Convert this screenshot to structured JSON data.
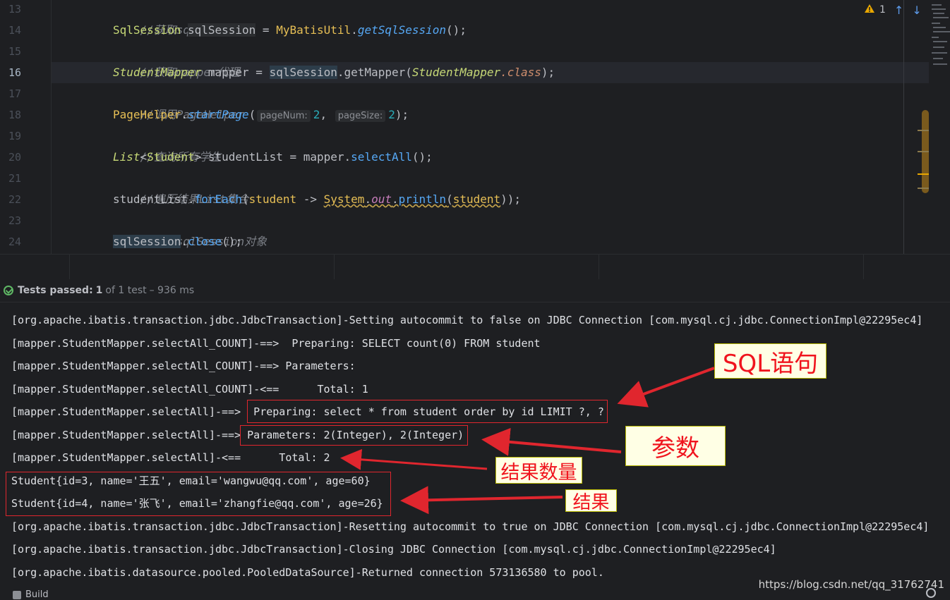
{
  "editor": {
    "line_numbers": [
      "13",
      "14",
      "15",
      "16",
      "17",
      "18",
      "19",
      "20",
      "21",
      "22",
      "23",
      "24"
    ],
    "current_line": "16",
    "inspection": {
      "warning_count": "1"
    },
    "lines": {
      "l13": "//获取sqlSession",
      "l14": {
        "type": "SqlSession",
        "var": "sqlSession",
        "eq": " = ",
        "cls": "MyBatisUtil",
        "dot": ".",
        "method": "getSqlSession",
        "end": "();"
      },
      "l15": "//获取mapper代理",
      "l16": {
        "type": "StudentMapper",
        "var": " mapper = ",
        "recv": "sqlSession",
        "call": ".getMapper(",
        "arg": "StudentMapper",
        "kw": ".class",
        "end": ");"
      },
      "l17": "//调用PageHelper",
      "l18": {
        "cls": "PageHelper",
        "dot": ".",
        "method": "startPage",
        "open": "(",
        "hint1": "pageNum:",
        "v1": "2",
        "comma": ", ",
        "hint2": "pageSize:",
        "v2": "2",
        "end": ");"
      },
      "l19": "//查询所有学生",
      "l20": {
        "type": "List",
        "lt": "<",
        "generic": "Student",
        "rest": "> studentList = mapper.",
        "method": "selectAll",
        "end": "();"
      },
      "l21": "//遍历结果List集合",
      "l22": {
        "recv": "studentList.",
        "method": "forEach",
        "open": "(",
        "param": "student",
        "arrow": " -> ",
        "sys": "System",
        "dot": ".",
        "out": "out",
        "dot2": ".",
        "println": "println",
        "open2": "(",
        "arg": "student",
        "end": "));"
      },
      "l23": "//关闭sqlSession对象",
      "l24": {
        "recv": "sqlSession",
        "dot": ".",
        "method": "close",
        "end": "();"
      }
    }
  },
  "test_status": {
    "prefix": "Tests passed:",
    "passed": "1",
    "suffix": "of 1 test",
    "duration": "– 936 ms"
  },
  "console": {
    "lines": [
      "[org.apache.ibatis.transaction.jdbc.JdbcTransaction]-Setting autocommit to false on JDBC Connection [com.mysql.cj.jdbc.ConnectionImpl@22295ec4]",
      "[mapper.StudentMapper.selectAll_COUNT]-==>  Preparing: SELECT count(0) FROM student",
      "[mapper.StudentMapper.selectAll_COUNT]-==> Parameters: ",
      "[mapper.StudentMapper.selectAll_COUNT]-<==      Total: 1",
      "[mapper.StudentMapper.selectAll]-==>  Preparing: select * from student order by id LIMIT ?, ?",
      "[mapper.StudentMapper.selectAll]-==> Parameters: 2(Integer), 2(Integer)",
      "[mapper.StudentMapper.selectAll]-<==      Total: 2",
      "Student{id=3, name='王五', email='wangwu@qq.com', age=60}",
      "Student{id=4, name='张飞', email='zhangfie@qq.com', age=26}",
      "[org.apache.ibatis.transaction.jdbc.JdbcTransaction]-Resetting autocommit to true on JDBC Connection [com.mysql.cj.jdbc.ConnectionImpl@22295ec4]",
      "[org.apache.ibatis.transaction.jdbc.JdbcTransaction]-Closing JDBC Connection [com.mysql.cj.jdbc.ConnectionImpl@22295ec4]",
      "[org.apache.ibatis.datasource.pooled.PooledDataSource]-Returned connection 573136580 to pool."
    ]
  },
  "annotations": {
    "sql": "SQL语句",
    "params": "参数",
    "count": "结果数量",
    "result": "结果",
    "colors": {
      "box": "#e0262e",
      "label_bg": "#ffffe5",
      "label_text": "#f0141e"
    }
  },
  "bottom": {
    "build_tab": "Build",
    "watermark": "https://blog.csdn.net/qq_31762741"
  },
  "colors": {
    "background": "#1e1f22",
    "comment": "#7a7e85",
    "type": "#c7d977",
    "method": "#56a8f5",
    "number": "#2aacb8",
    "passed": "#5fb865"
  }
}
